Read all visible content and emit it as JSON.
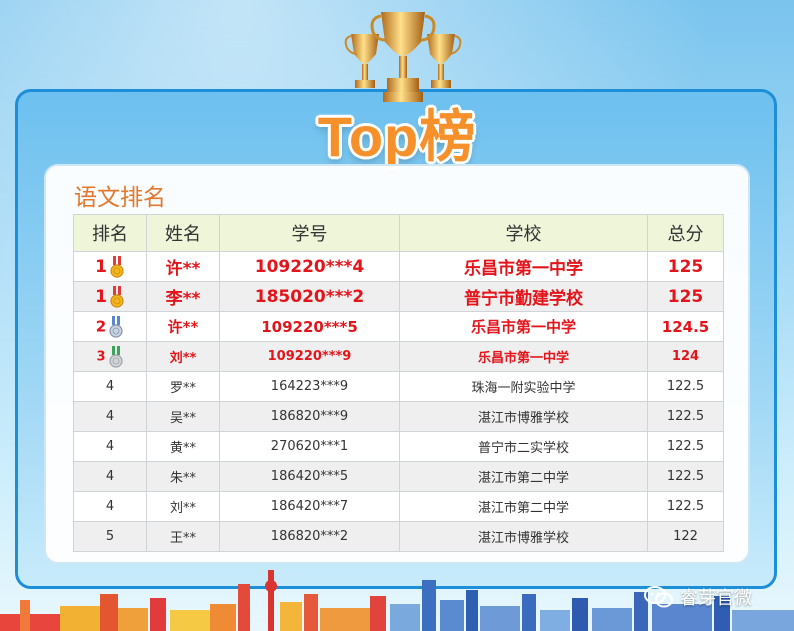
{
  "banner": {
    "title": "Top榜"
  },
  "section": {
    "subject": "语文排名"
  },
  "table": {
    "headers": [
      "排名",
      "姓名",
      "学号",
      "学校",
      "总分"
    ],
    "rows": [
      {
        "rank": "1",
        "name": "许**",
        "id": "109220***4",
        "school": "乐昌市第一中学",
        "score": "125",
        "medal": "gold"
      },
      {
        "rank": "1",
        "name": "李**",
        "id": "185020***2",
        "school": "普宁市勤建学校",
        "score": "125",
        "medal": "gold"
      },
      {
        "rank": "2",
        "name": "许**",
        "id": "109220***5",
        "school": "乐昌市第一中学",
        "score": "124.5",
        "medal": "silver"
      },
      {
        "rank": "3",
        "name": "刘**",
        "id": "109220***9",
        "school": "乐昌市第一中学",
        "score": "124",
        "medal": "bronze"
      },
      {
        "rank": "4",
        "name": "罗**",
        "id": "164223***9",
        "school": "珠海一附实验中学",
        "score": "122.5"
      },
      {
        "rank": "4",
        "name": "吴**",
        "id": "186820***9",
        "school": "湛江市博雅学校",
        "score": "122.5"
      },
      {
        "rank": "4",
        "name": "黄**",
        "id": "270620***1",
        "school": "普宁市二实学校",
        "score": "122.5"
      },
      {
        "rank": "4",
        "name": "朱**",
        "id": "186420***5",
        "school": "湛江市第二中学",
        "score": "122.5"
      },
      {
        "rank": "4",
        "name": "刘**",
        "id": "186420***7",
        "school": "湛江市第二中学",
        "score": "122.5"
      },
      {
        "rank": "5",
        "name": "王**",
        "id": "186820***2",
        "school": "湛江市博雅学校",
        "score": "122"
      }
    ]
  },
  "watermark": {
    "text": "睿芽官微",
    "icon": "wechat-icon"
  },
  "colors": {
    "accent": "#f5902a",
    "highlight": "#e4141b",
    "frame": "#1d8fd8",
    "header_bg": "#eef5d8"
  }
}
